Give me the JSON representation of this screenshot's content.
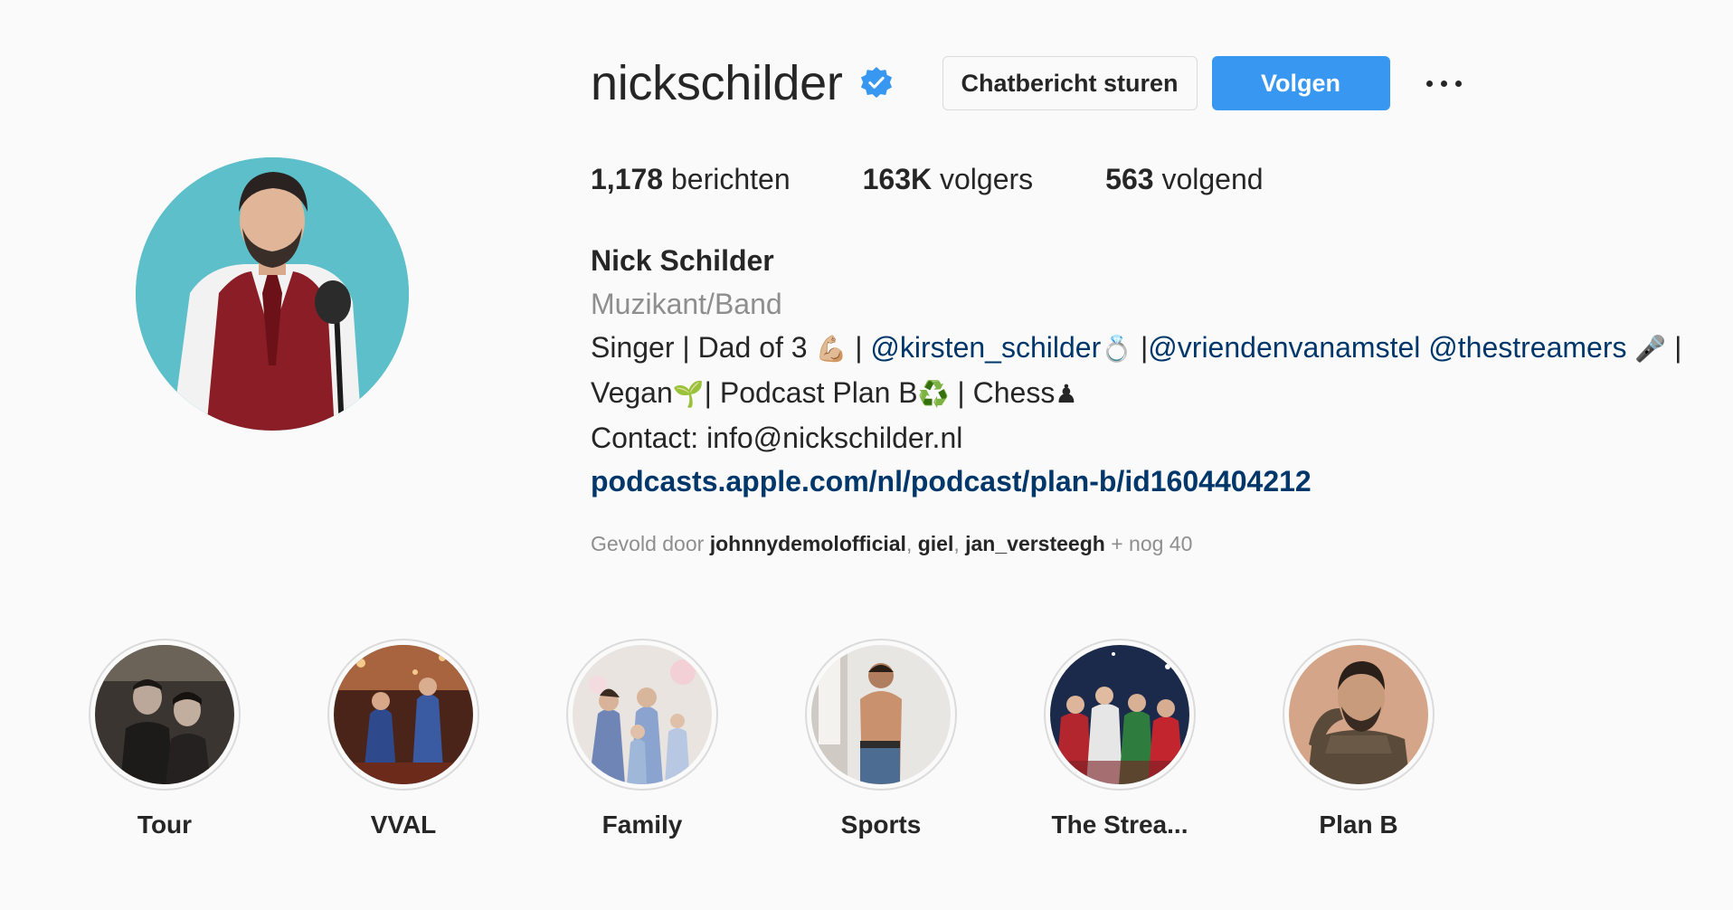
{
  "profile": {
    "username": "nickschilder",
    "verified": true,
    "buttons": {
      "message": "Chatbericht sturen",
      "follow": "Volgen"
    },
    "stats": [
      {
        "value": "1,178",
        "label": "berichten"
      },
      {
        "value": "163K",
        "label": "volgers"
      },
      {
        "value": "563",
        "label": "volgend"
      }
    ],
    "full_name": "Nick Schilder",
    "category": "Muzikant/Band",
    "bio": {
      "line1_a": "Singer | Dad of 3 ",
      "line1_emoji1": "💪🏼",
      "line1_b": " | ",
      "mention1": "@kirsten_schilder",
      "line1_emoji2": "💍",
      "line1_c": " |",
      "mention2": "@vriendenvanamstel",
      "line1_d": " ",
      "mention3": "@thestreamers",
      "line1_e": " ",
      "line1_emoji3": "🎤",
      "line1_f": " |",
      "line2_a": "Vegan",
      "line2_emoji1": "🌱",
      "line2_b": "| Podcast Plan B",
      "line2_emoji2": "♻️",
      "line2_c": " | Chess",
      "line2_emoji3": "♟",
      "contact": "Contact: info@nickschilder.nl",
      "link": "podcasts.apple.com/nl/podcast/plan-b/id1604404212"
    },
    "followed_by": {
      "prefix": "Gevold door ",
      "users": [
        "johnnydemolofficial",
        "giel",
        "jan_versteegh"
      ],
      "separator": ", ",
      "suffix": " + nog 40"
    }
  },
  "highlights": [
    {
      "label": "Tour"
    },
    {
      "label": "VVAL"
    },
    {
      "label": "Family"
    },
    {
      "label": "Sports"
    },
    {
      "label": "The Strea..."
    },
    {
      "label": "Plan B"
    }
  ],
  "colors": {
    "background": "#fafafa",
    "follow_button": "#3897f0",
    "link": "#00376b",
    "muted": "#8e8e8e",
    "verified_badge": "#3897f0",
    "avatar_bg": "#5cbfc9"
  },
  "icons": {
    "verified": "verified-badge-icon",
    "more": "more-options-icon"
  }
}
